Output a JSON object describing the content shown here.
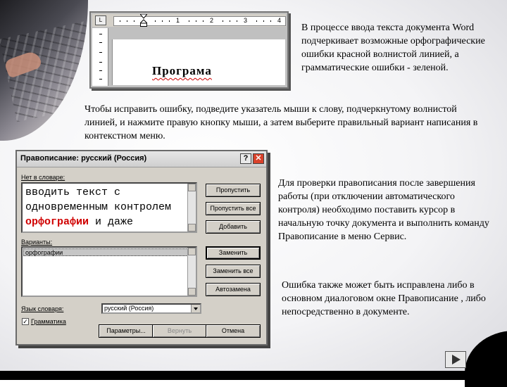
{
  "word_preview": {
    "ruler_tab_glyph": "L",
    "ruler_numbers": [
      "1",
      "2",
      "3",
      "4"
    ],
    "misspelled_word": "Програма",
    "underline_color": "#d00000"
  },
  "paragraphs": {
    "p1": "В процессе ввода текста документа Word подчеркивает возможные орфографические ошибки красной волнистой линией, а грамматические ошибки - зеленой.",
    "p2": "Чтобы исправить ошибку, подведите указатель мыши к слову, подчеркнутому волнистой линией, и нажмите правую кнопку мыши, а затем выберите правильный вариант написания в контекстном меню.",
    "p3": "Для проверки правописания после завершения работы (при отключении автоматического контроля) необходимо поставить курсор в начальную точку документа и выполнить команду Правописание в меню Сервис.",
    "p4": "Ошибка также может быть исправлена либо в основном диалоговом окне Правописание , либо непосредственно в документе."
  },
  "dialog": {
    "title": "Правописание: русский (Россия)",
    "help_glyph": "?",
    "close_glyph": "✕",
    "not_in_dict_label": "Нет в словаре:",
    "text_before": "вводить текст с одновременным контролем",
    "text_error": "орфографии",
    "text_after": "и даже стилистики на экране:",
    "suggestions_label": "Варианты:",
    "suggestions": [
      "орфографии"
    ],
    "dict_lang_label": "Язык словаря:",
    "dict_lang_value": "русский (Россия)",
    "grammar_label": "Грамматика",
    "grammar_checked": true,
    "check_glyph": "✓",
    "buttons": {
      "skip": "Пропустить",
      "skip_all": "Пропустить все",
      "add": "Добавить",
      "change": "Заменить",
      "change_all": "Заменить все",
      "autocorrect": "Автозамена",
      "options": "Параметры...",
      "undo": "Вернуть",
      "cancel": "Отмена"
    }
  },
  "colors": {
    "error_red": "#d00000",
    "dialog_face": "#d4d0c8",
    "close_button": "#d9412a"
  }
}
